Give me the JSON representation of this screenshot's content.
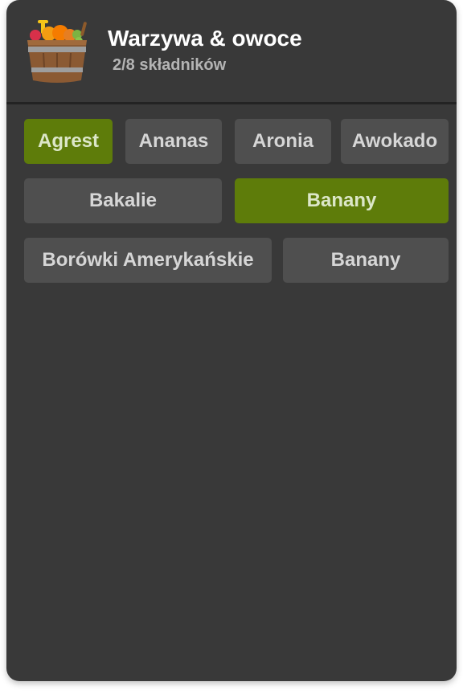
{
  "header": {
    "title": "Warzywa & owoce",
    "subtitle": "2/8 składników",
    "icon": "fruit-basket-icon"
  },
  "colors": {
    "card_background": "#393939",
    "chip_background": "#4f4f4f",
    "chip_selected": "#5e7c0a",
    "divider": "#232323"
  },
  "ingredients": [
    {
      "label": "Agrest",
      "selected": true
    },
    {
      "label": "Ananas",
      "selected": false
    },
    {
      "label": "Aronia",
      "selected": false
    },
    {
      "label": "Awokado",
      "selected": false
    },
    {
      "label": "Bakalie",
      "selected": false
    },
    {
      "label": "Banany",
      "selected": true
    },
    {
      "label": "Borówki Amerykańskie",
      "selected": false
    },
    {
      "label": "Banany",
      "selected": false
    }
  ]
}
